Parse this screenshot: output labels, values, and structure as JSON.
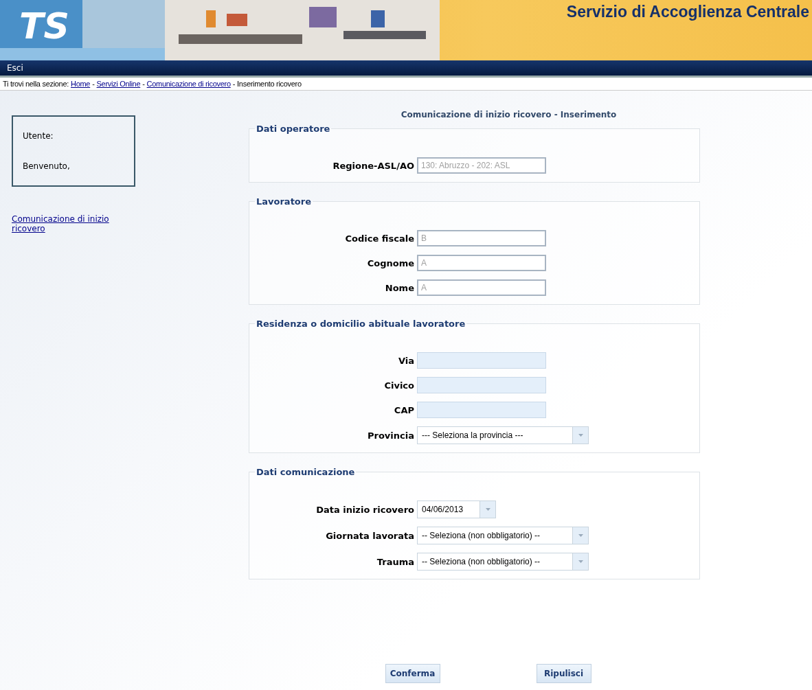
{
  "header": {
    "logo": "TS",
    "title": "Servizio di Accoglienza Centrale"
  },
  "nav": {
    "items": [
      "Esci"
    ]
  },
  "breadcrumb": {
    "prefix": "Ti trovi nella sezione:",
    "items": [
      {
        "kind": "link",
        "text": "Home"
      },
      {
        "kind": "separator",
        "text": "-"
      },
      {
        "kind": "link",
        "text": "Servizi Online"
      },
      {
        "kind": "separator",
        "text": "-"
      },
      {
        "kind": "link",
        "text": "Comunicazione di ricovero"
      },
      {
        "kind": "separator",
        "text": "-"
      },
      {
        "kind": "current",
        "text": "Inserimento ricovero"
      }
    ]
  },
  "sidebar": {
    "user_label": "Utente:",
    "welcome": "Benvenuto,",
    "links": [
      "Comunicazione di inizio ricovero"
    ]
  },
  "page_title": "Comunicazione di inizio ricovero - Inserimento",
  "sections": [
    {
      "legend": "Dati operatore",
      "fields": [
        {
          "kind": "text",
          "label": "Regione-ASL/AO",
          "value": "130: Abruzzo - 202: ASL",
          "disabled": true
        }
      ]
    },
    {
      "legend": "Lavoratore",
      "fields": [
        {
          "kind": "text",
          "label": "Codice fiscale",
          "value": "B",
          "disabled": true
        },
        {
          "kind": "text",
          "label": "Cognome",
          "value": "A",
          "disabled": true
        },
        {
          "kind": "text",
          "label": "Nome",
          "value": "A",
          "disabled": true
        }
      ]
    },
    {
      "legend": "Residenza o domicilio abituale lavoratore",
      "fields": [
        {
          "kind": "text",
          "label": "Via",
          "disabled": false
        },
        {
          "kind": "text",
          "label": "Civico",
          "disabled": false
        },
        {
          "kind": "text",
          "label": "CAP",
          "disabled": false
        },
        {
          "kind": "select",
          "label": "Provincia",
          "value": "--- Seleziona la provincia ---"
        }
      ]
    },
    {
      "legend": "Dati comunicazione",
      "fields": [
        {
          "kind": "date",
          "label": "Data inizio ricovero",
          "value": "04/06/2013"
        },
        {
          "kind": "select",
          "label": "Giornata lavorata",
          "value": "-- Seleziona (non obbligatorio) --"
        },
        {
          "kind": "select",
          "label": "Trauma",
          "value": "-- Seleziona (non obbligatorio) --"
        }
      ]
    }
  ],
  "buttons": [
    "Conferma",
    "Ripulisci"
  ]
}
